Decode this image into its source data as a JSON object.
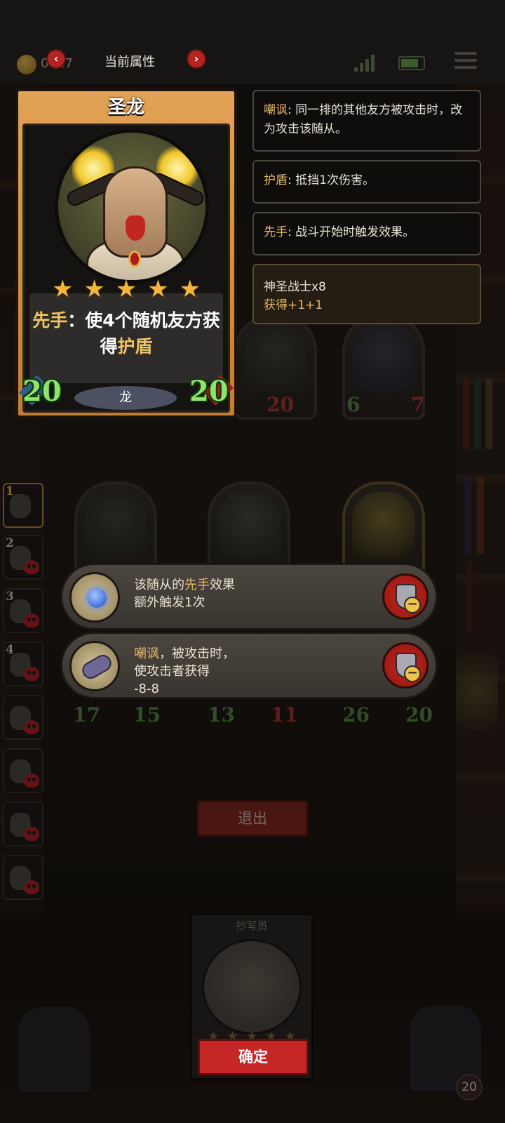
{
  "topbar": {
    "coin_text": "0017",
    "prev_icon": "‹",
    "next_icon": "›",
    "title": "当前属性"
  },
  "card": {
    "name": "圣龙",
    "star_count": 5,
    "desc_prefix": "先手",
    "desc_middle": "：使4个随机友方获得",
    "desc_keyword": "护盾",
    "attack": "20",
    "health": "20",
    "tribe": "龙"
  },
  "tooltips": [
    {
      "keyword": "嘲讽",
      "text": ": 同一排的其他友方被攻击时，改为攻击该随从。"
    },
    {
      "keyword": "护盾",
      "text": ": 抵挡1次伤害。"
    },
    {
      "keyword": "先手",
      "text": ": 战斗开始时触发效果。"
    }
  ],
  "synergy": {
    "line1": "神圣战士x8",
    "line2": "获得+1+1"
  },
  "board_top_stats": [
    {
      "attack": "",
      "health": "20"
    },
    {
      "attack": "6",
      "health": "7"
    }
  ],
  "board_bottom_stats": [
    {
      "attack": "17",
      "health": "15"
    },
    {
      "attack": "13",
      "health": "11"
    },
    {
      "attack": "26",
      "health": "20"
    }
  ],
  "side_slots": [
    "1",
    "2",
    "3",
    "4",
    "",
    "",
    "",
    ""
  ],
  "effects": [
    {
      "pre": "该随从的",
      "keyword": "先手",
      "post": "效果",
      "line2": "额外触发1次",
      "line3": ""
    },
    {
      "pre": "",
      "keyword": "嘲讽",
      "post": "，被攻击时，",
      "line2": "使攻击者获得",
      "line3": "-8-8"
    }
  ],
  "exit_label": "退出",
  "shop_card": {
    "name": "抄写员",
    "star_count": 5
  },
  "confirm_label": "确定",
  "corner_badge": "20",
  "colors": {
    "accent_gold": "#f0c466",
    "button_red": "#c52726",
    "attack_green": "#8fe36a"
  }
}
